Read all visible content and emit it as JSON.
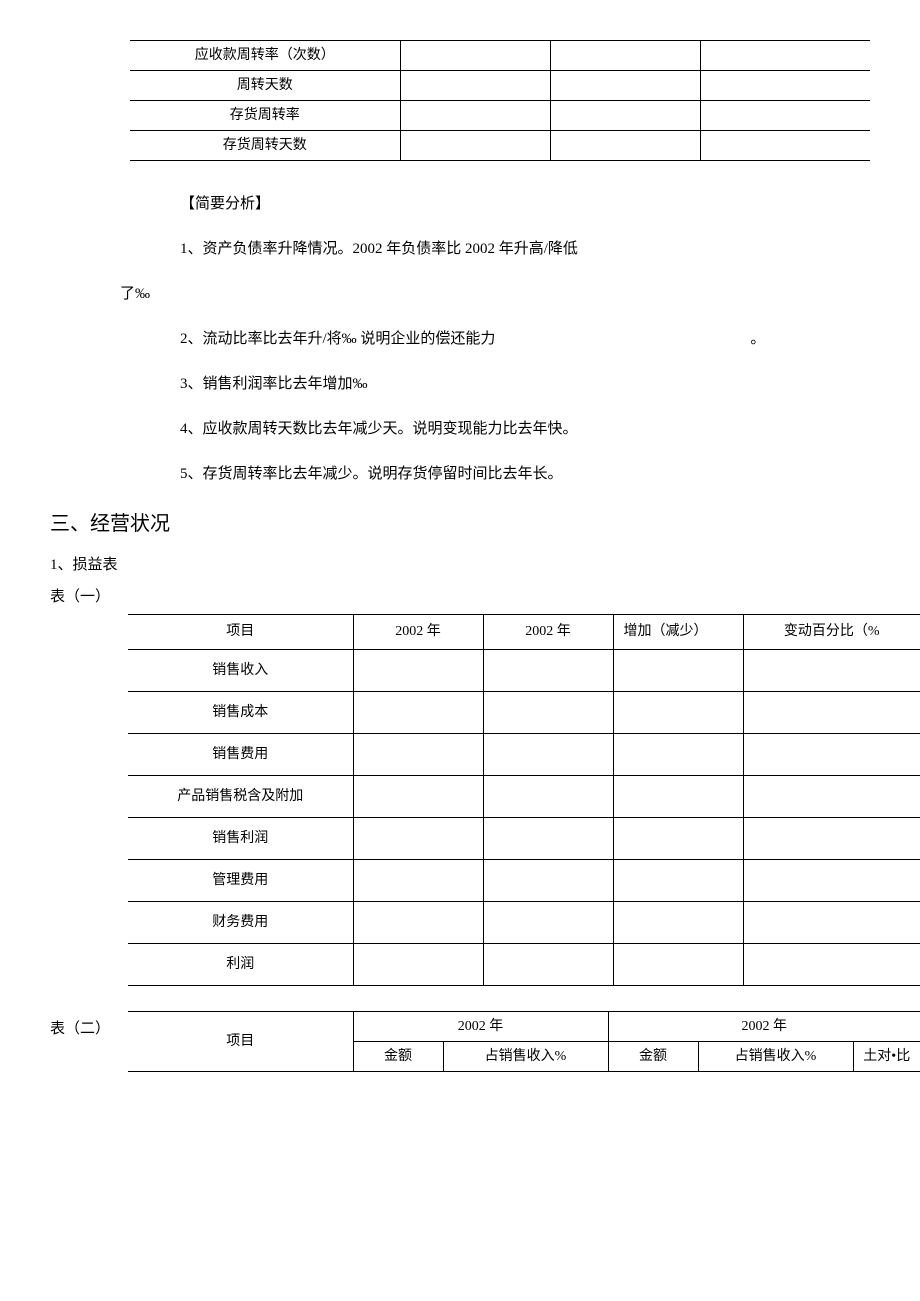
{
  "table1": {
    "rows": [
      "应收款周转率（次数）",
      "周转天数",
      "存货周转率",
      "存货周转天数"
    ]
  },
  "analysis": {
    "header": "【简要分析】",
    "item1": "1、资产负债率升降情况。2002 年负债率比 2002 年升高/降低",
    "item1_cont": "了‰",
    "item2_a": "2、流动比率比去年升/将‰ 说明企业的偿还能力",
    "item2_b": "。",
    "item3": "3、销售利润率比去年增加‰",
    "item4": "4、应收款周转天数比去年减少天。说明变现能力比去年快。",
    "item5": "5、存货周转率比去年减少。说明存货停留时间比去年长。"
  },
  "section3": {
    "heading": "三、经营状况",
    "sub1": "1、损益表",
    "table_label_1": "表（一）",
    "table_label_2": "表（二）"
  },
  "table2": {
    "headers": {
      "col1": "项目",
      "col2": "2002 年",
      "col3": "2002 年",
      "col4": "增加（减少）",
      "col5": "变动百分比（%"
    },
    "rows": [
      "销售收入",
      "销售成本",
      "销售费用",
      "产品销售税含及附加",
      "销售利润",
      "管理费用",
      "财务费用",
      "利润"
    ]
  },
  "table3": {
    "headers": {
      "col1": "项目",
      "col_year1": "2002 年",
      "col_year2": "2002 年",
      "sub_amount": "金额",
      "sub_percent": "占销售收入%",
      "sub_compare": "土对•比"
    }
  }
}
